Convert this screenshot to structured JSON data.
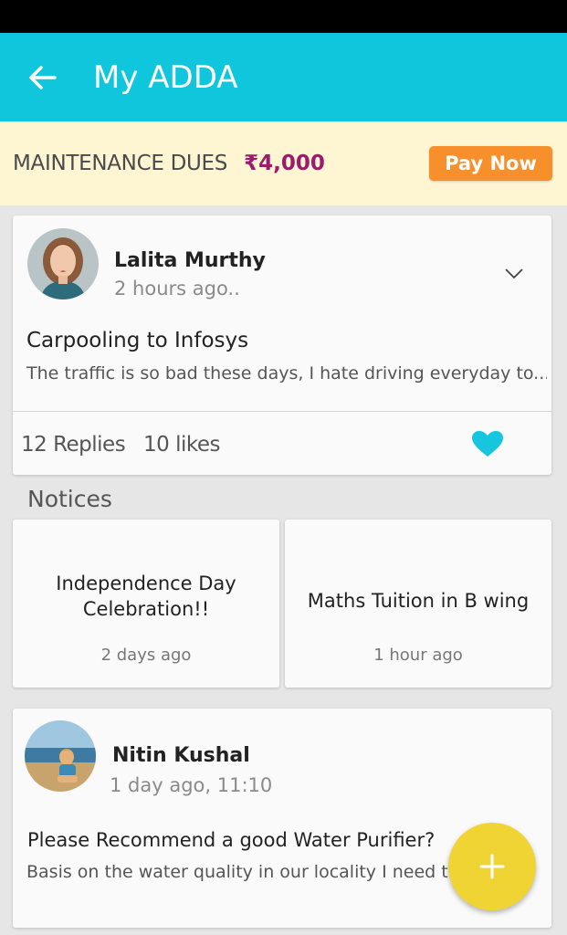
{
  "app_bar": {
    "title": "My ADDA",
    "background": "#10c6dc"
  },
  "dues": {
    "label": "MAINTENANCE DUES",
    "amount": "₹4,000",
    "pay_label": "Pay Now",
    "pay_color": "#f7902b"
  },
  "post1": {
    "author": "Lalita Murthy",
    "time": "2 hours ago..",
    "title": "Carpooling to Infosys",
    "excerpt": "The traffic is so bad these days, I hate driving everyday to...",
    "replies": "12 Replies",
    "likes": "10 likes",
    "icons": [
      "chevron-down-icon",
      "heart-icon"
    ]
  },
  "notices": {
    "title": "Notices",
    "items": [
      {
        "title": "Independence Day Celebration!!",
        "time": "2 days ago"
      },
      {
        "title": "Maths Tuition in B wing",
        "time": "1 hour ago"
      }
    ]
  },
  "post2": {
    "author": "Nitin Kushal",
    "time": "1 day ago, 11:10",
    "title": "Please Recommend a good Water Purifier?",
    "excerpt": "Basis on the water quality in our locality I need to"
  },
  "fab": {
    "icon": "plus-icon",
    "color": "#f0d433"
  }
}
